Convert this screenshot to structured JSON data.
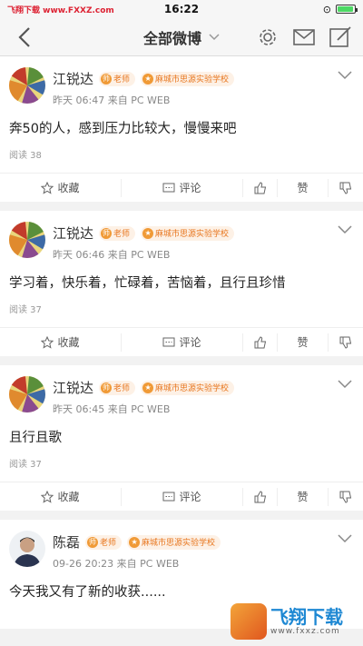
{
  "status": {
    "carrier": "飞翔下载 www.FXXZ.com",
    "time": "16:22"
  },
  "header": {
    "title": "全部微博"
  },
  "posts": [
    {
      "name": "江锐达",
      "role": "老师",
      "school": "麻城市思源实验学校",
      "time": "昨天 06:47 来自 PC WEB",
      "text": "奔50的人，感到压力比较大，慢慢来吧",
      "reads": "阅读 38",
      "fav": "收藏",
      "comment": "评论",
      "like": "赞"
    },
    {
      "name": "江锐达",
      "role": "老师",
      "school": "麻城市思源实验学校",
      "time": "昨天 06:46 来自 PC WEB",
      "text": "学习着，快乐着，忙碌着，苦恼着，且行且珍惜",
      "reads": "阅读 37",
      "fav": "收藏",
      "comment": "评论",
      "like": "赞"
    },
    {
      "name": "江锐达",
      "role": "老师",
      "school": "麻城市思源实验学校",
      "time": "昨天 06:45 来自 PC WEB",
      "text": "且行且歌",
      "reads": "阅读 37",
      "fav": "收藏",
      "comment": "评论",
      "like": "赞"
    },
    {
      "name": "陈磊",
      "role": "老师",
      "school": "麻城市思源实验学校",
      "time": "09-26 20:23 来自 PC WEB",
      "text": "今天我又有了新的收获......"
    }
  ],
  "watermark": {
    "text": "飞翔下载",
    "url": "www.fxxz.com"
  },
  "colors": {
    "accent": "#e8761e",
    "badge_bg": "#fdf1e6"
  },
  "icons": [
    "back-icon",
    "gear-icon",
    "mail-icon",
    "compose-icon",
    "star-icon",
    "comment-icon",
    "thumb-up-icon",
    "thumb-down-icon",
    "chevron-down-icon"
  ]
}
